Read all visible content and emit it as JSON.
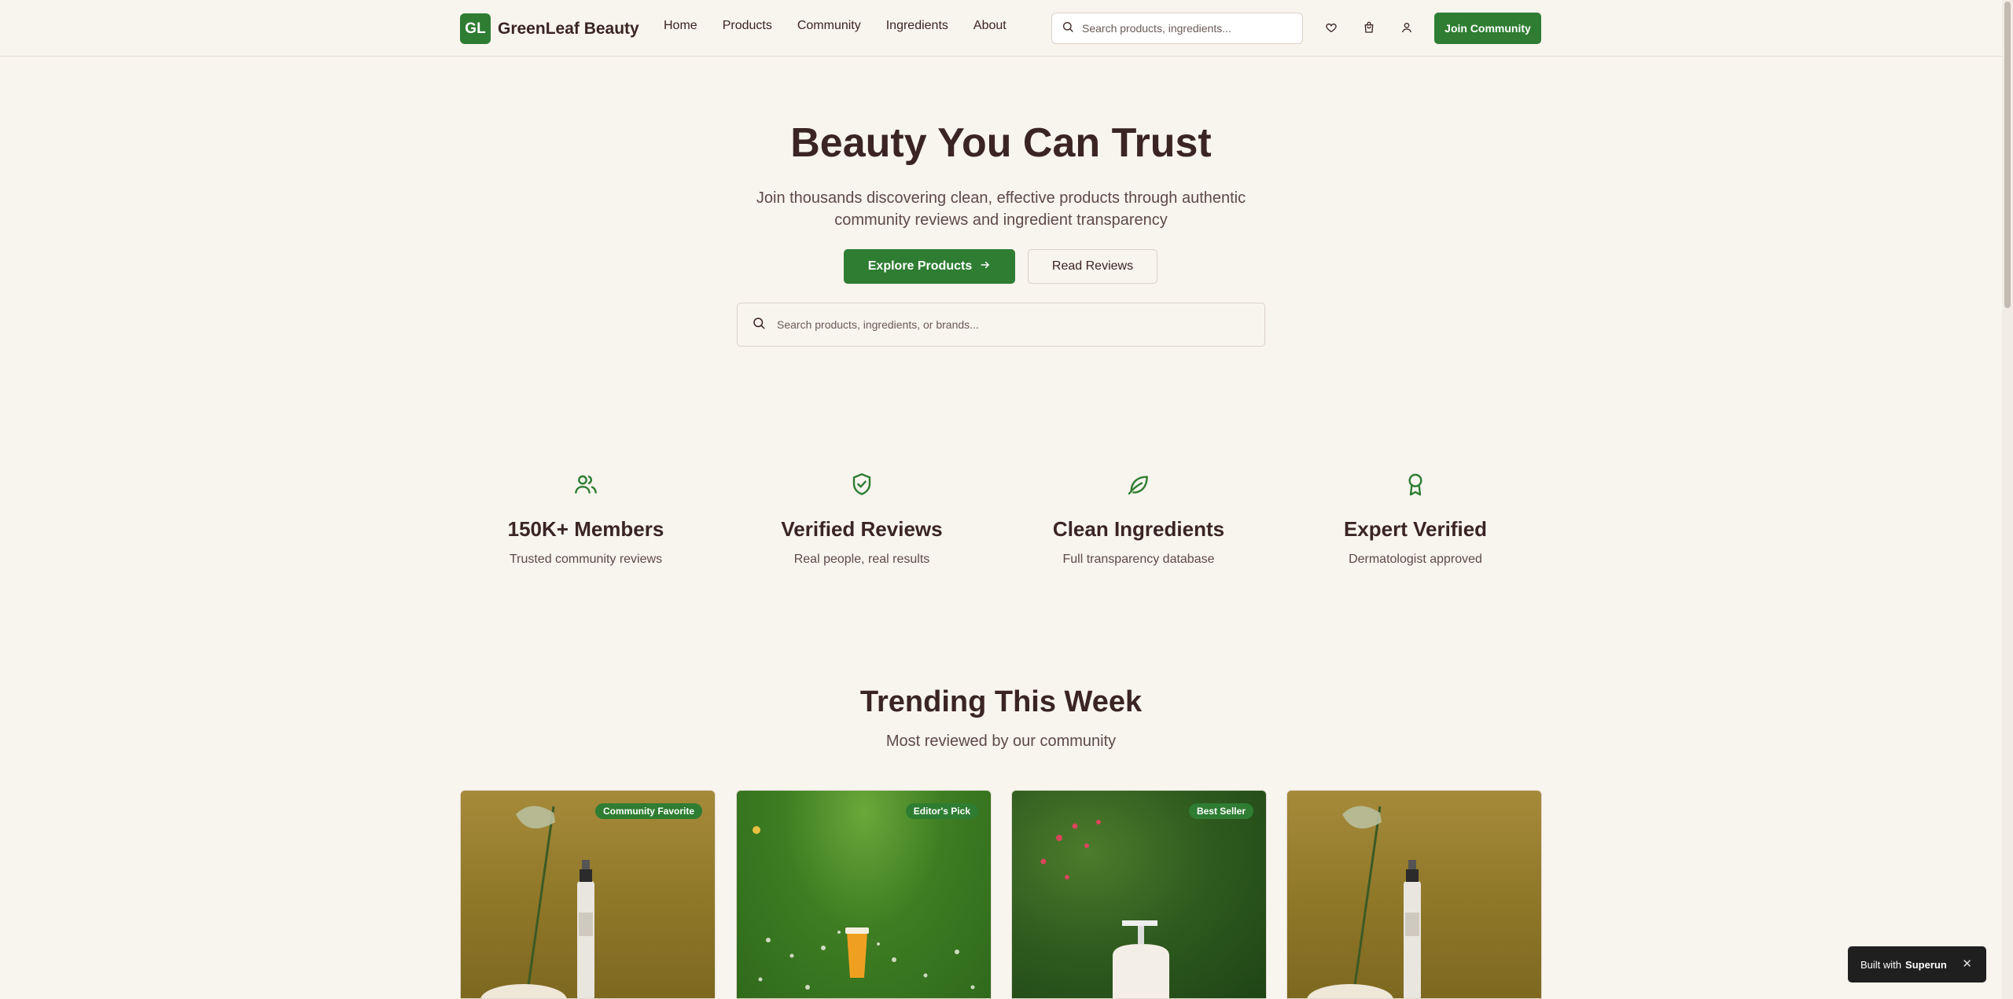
{
  "header": {
    "logo_badge": "GL",
    "brand": "GreenLeaf Beauty",
    "nav": [
      "Home",
      "Products",
      "Community",
      "Ingredients",
      "About"
    ],
    "search_placeholder": "Search products, ingredients...",
    "join_label": "Join Community",
    "icons": [
      "heart-icon",
      "shopping-bag-icon",
      "user-icon"
    ]
  },
  "hero": {
    "title": "Beauty You Can Trust",
    "subtitle": "Join thousands discovering clean, effective products through authentic community reviews and ingredient transparency",
    "primary_cta": "Explore Products",
    "secondary_cta": "Read Reviews",
    "search_placeholder": "Search products, ingredients, or brands..."
  },
  "features": [
    {
      "icon": "users-icon",
      "title": "150K+ Members",
      "desc": "Trusted community reviews"
    },
    {
      "icon": "shield-check-icon",
      "title": "Verified Reviews",
      "desc": "Real people, real results"
    },
    {
      "icon": "leaf-icon",
      "title": "Clean Ingredients",
      "desc": "Full transparency database"
    },
    {
      "icon": "award-icon",
      "title": "Expert Verified",
      "desc": "Dermatologist approved"
    }
  ],
  "trending": {
    "title": "Trending This Week",
    "subtitle": "Most reviewed by our community",
    "cards": [
      {
        "badge": "Community Favorite",
        "image": "serum-bottle-with-flower"
      },
      {
        "badge": "Editor's Pick",
        "image": "cup-in-grass"
      },
      {
        "badge": "Best Seller",
        "image": "pump-bottle-in-garden"
      },
      {
        "badge": "",
        "image": "serum-bottle-with-flower"
      }
    ]
  },
  "toast": {
    "prefix": "Built with",
    "brand": "Superun",
    "close": "✕"
  },
  "colors": {
    "accent": "#2e7d32",
    "background": "#f8f4ee",
    "text": "#3a2522"
  }
}
